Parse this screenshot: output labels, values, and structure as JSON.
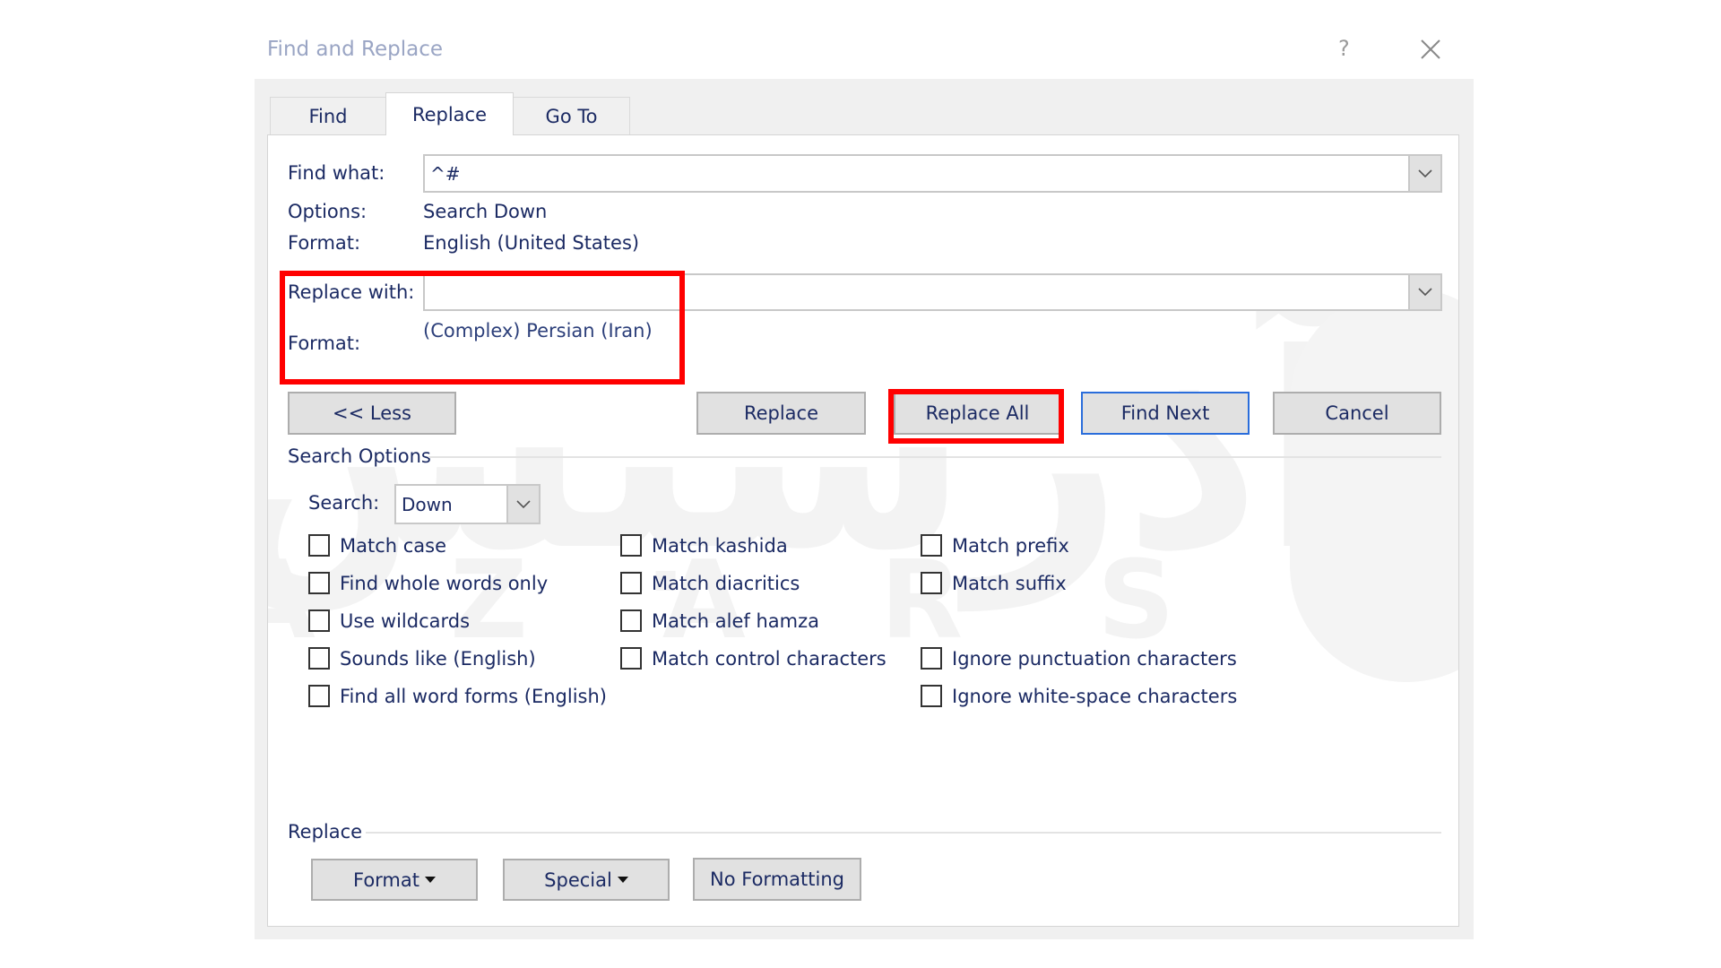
{
  "window": {
    "title": "Find and Replace",
    "help_glyph": "?",
    "close_icon": "close-icon"
  },
  "tabs": [
    {
      "label": "Find",
      "active": false
    },
    {
      "label": "Replace",
      "active": true
    },
    {
      "label": "Go To",
      "active": false
    }
  ],
  "find": {
    "label": "Find what:",
    "value": "^#",
    "options_label": "Options:",
    "options_value": "Search Down",
    "format_label": "Format:",
    "format_value": "English (United States)"
  },
  "replace": {
    "label": "Replace with:",
    "value": "",
    "format_label": "Format:",
    "format_value": "(Complex) Persian (Iran)"
  },
  "buttons": {
    "less": "<< Less",
    "replace": "Replace",
    "replace_all": "Replace All",
    "find_next": "Find Next",
    "cancel": "Cancel"
  },
  "search_options": {
    "heading": "Search Options",
    "search_label": "Search:",
    "search_value": "Down",
    "checkboxes": [
      {
        "label": "Match case",
        "checked": false
      },
      {
        "label": "Find whole words only",
        "checked": false
      },
      {
        "label": "Use wildcards",
        "checked": false
      },
      {
        "label": "Sounds like (English)",
        "checked": false
      },
      {
        "label": "Find all word forms (English)",
        "checked": false
      },
      {
        "label": "Match kashida",
        "checked": false
      },
      {
        "label": "Match diacritics",
        "checked": false
      },
      {
        "label": "Match alef hamza",
        "checked": false
      },
      {
        "label": "Match control characters",
        "checked": false
      },
      {
        "label": "Match prefix",
        "checked": false
      },
      {
        "label": "Match suffix",
        "checked": false
      },
      {
        "label": "Ignore punctuation characters",
        "checked": false
      },
      {
        "label": "Ignore white-space characters",
        "checked": false
      }
    ]
  },
  "replace_section": {
    "heading": "Replace",
    "format_button": "Format",
    "special_button": "Special",
    "no_formatting_button": "No Formatting"
  },
  "highlight": {
    "color": "#ff0000",
    "targets": [
      "replace-with-format-area",
      "replace-all-button"
    ]
  },
  "watermark": {
    "text": "AZARSYS"
  }
}
